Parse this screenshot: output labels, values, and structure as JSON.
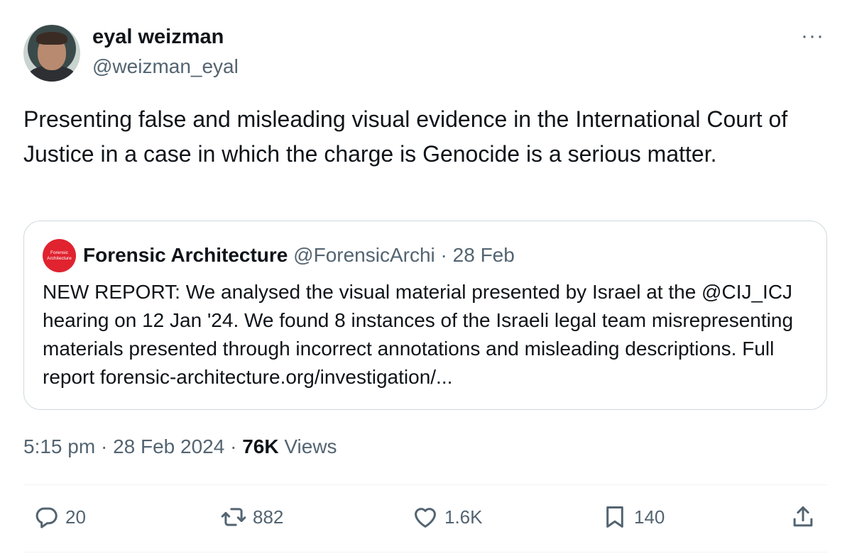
{
  "author": {
    "name": "eyal weizman",
    "handle": "@weizman_eyal"
  },
  "more_label": "···",
  "tweet": {
    "text": "Presenting false and misleading visual evidence in the International Court of Justice in a case in which the charge is Genocide is a serious matter."
  },
  "quoted": {
    "avatar_lines": [
      "Forensic",
      "Architecture"
    ],
    "name": "Forensic Architecture",
    "handle": "@ForensicArchi",
    "separator": " · ",
    "date": "28 Feb",
    "text": "NEW REPORT: We analysed the visual material presented by Israel at the @CIJ_ICJ hearing on 12 Jan '24. We found 8 instances of the Israeli legal team misrepresenting materials presented through incorrect annotations and misleading descriptions. Full report forensic-architecture.org/investigation/..."
  },
  "meta": {
    "time": "5:15 pm",
    "sep1": " · ",
    "date": "28 Feb 2024",
    "sep2": " · ",
    "views_count": "76K",
    "views_label": " Views"
  },
  "actions": {
    "reply_count": "20",
    "retweet_count": "882",
    "like_count": "1.6K",
    "bookmark_count": "140"
  },
  "icons": {
    "reply": "reply-icon",
    "retweet": "retweet-icon",
    "like": "heart-icon",
    "bookmark": "bookmark-icon",
    "share": "share-icon"
  },
  "colors": {
    "text": "#0f1419",
    "secondary": "#536471",
    "border": "#cfd9de",
    "quote_avatar": "#e0232f"
  }
}
